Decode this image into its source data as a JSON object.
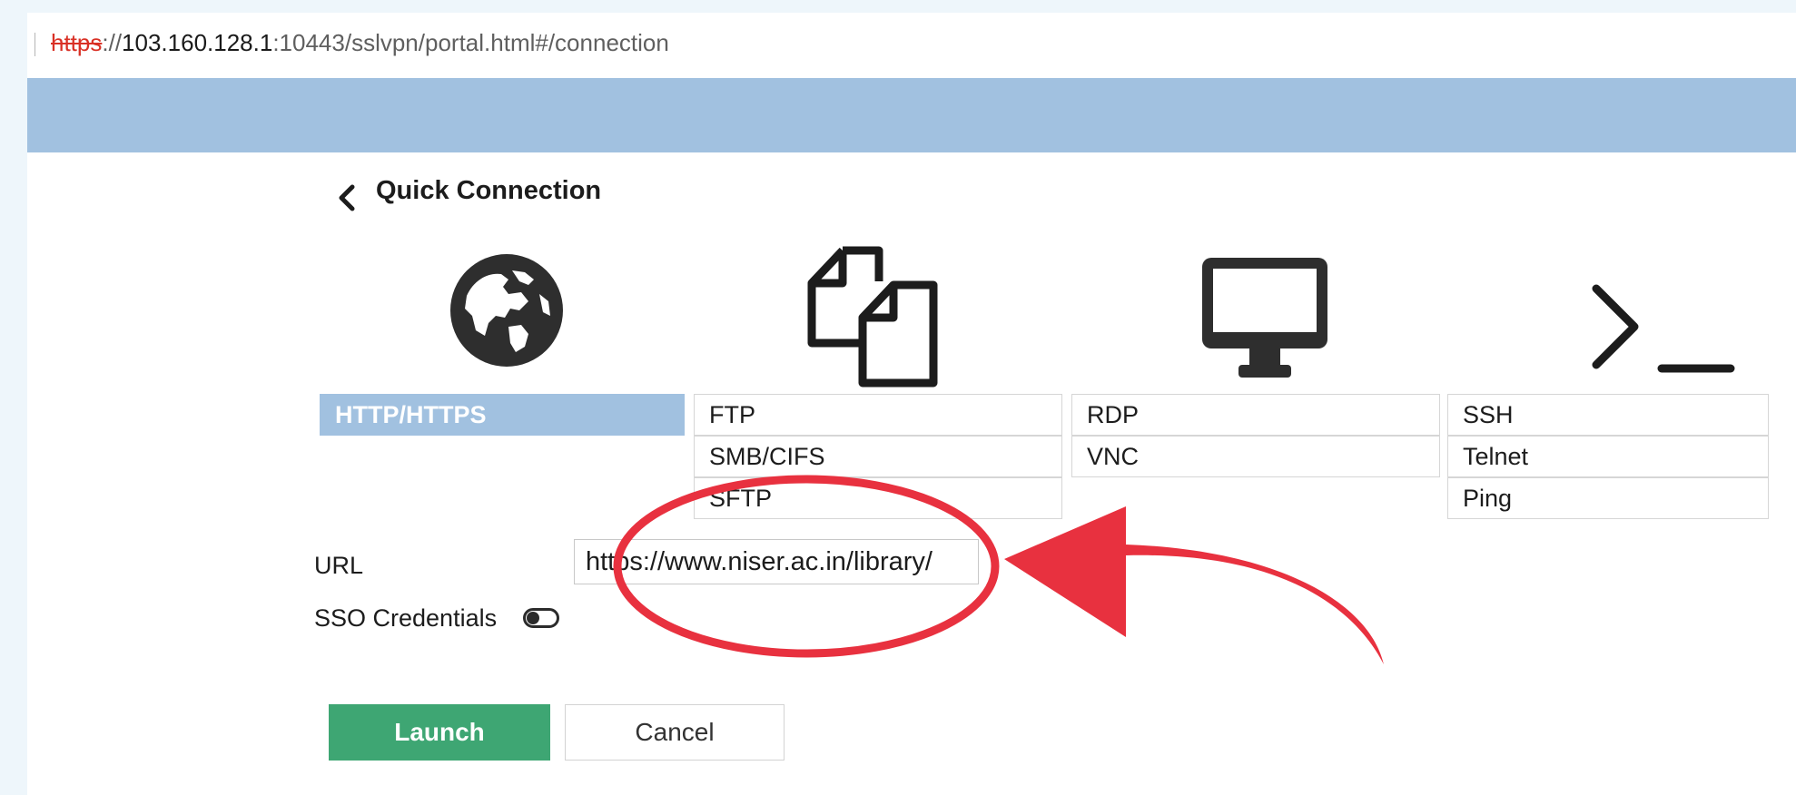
{
  "address_bar": {
    "scheme": "https",
    "host": "103.160.128.1",
    "rest": ":10443/sslvpn/portal.html#/connection"
  },
  "quick_connection": {
    "title": "Quick Connection",
    "icons": [
      "globe-icon",
      "files-icon",
      "monitor-icon",
      "terminal-icon"
    ],
    "columns": [
      {
        "items": [
          "HTTP/HTTPS"
        ],
        "selected": "HTTP/HTTPS"
      },
      {
        "items": [
          "FTP",
          "SMB/CIFS",
          "SFTP"
        ]
      },
      {
        "items": [
          "RDP",
          "VNC"
        ]
      },
      {
        "items": [
          "SSH",
          "Telnet",
          "Ping"
        ]
      }
    ]
  },
  "form": {
    "url_label": "URL",
    "url_value": "https://www.niser.ac.in/library/",
    "sso_label": "SSO Credentials",
    "sso_enabled": false
  },
  "buttons": {
    "launch": "Launch",
    "cancel": "Cancel"
  },
  "colors": {
    "header": "#a1c1e0",
    "selected_tab": "#a1c1e0",
    "launch_button": "#3ea673",
    "annotation": "#e8313f"
  }
}
